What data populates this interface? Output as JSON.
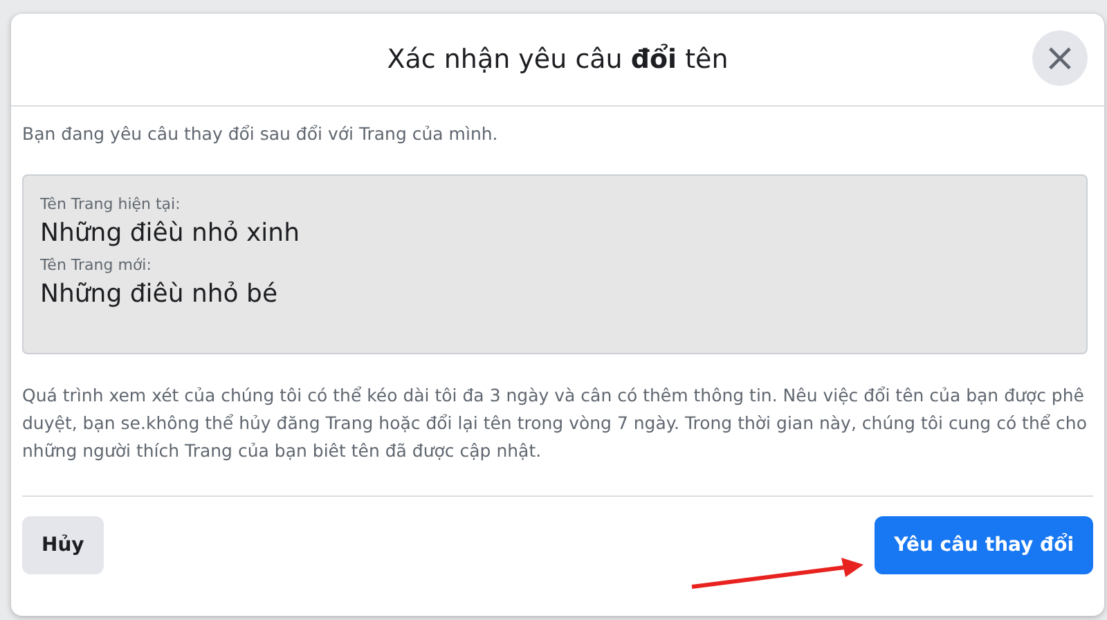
{
  "dialog": {
    "title": "Xác nhận yêu câu **đổi** tên",
    "close": "×",
    "intro": "Bạn đang yêu câu thay đổi sau đổi với Trang của mình.",
    "names": [
      {
        "label": "Tên Trang hiện tại:",
        "value": "Những điêù nhỏ xinh"
      },
      {
        "label": "Tên Trang mới:",
        "value": "Những điêù nhỏ bé"
      }
    ],
    "notice": "Quá trình xem xét của chúng tôi có thể kéo dài tôi đa 3 ngày và cân có thêm thông tin. Nêu việc đổi tên của bạn được phê duyệt, bạn se.không thể hủy đăng Trang hoặc đổi lại tên trong vòng 7 ngày. Trong thời gian này, chúng tôi cung có thể cho những người thích Trang của bạn biêt tên đã được cập nhật.",
    "cancel": "Hủy",
    "submit": "Yêu câu thay đổi"
  }
}
